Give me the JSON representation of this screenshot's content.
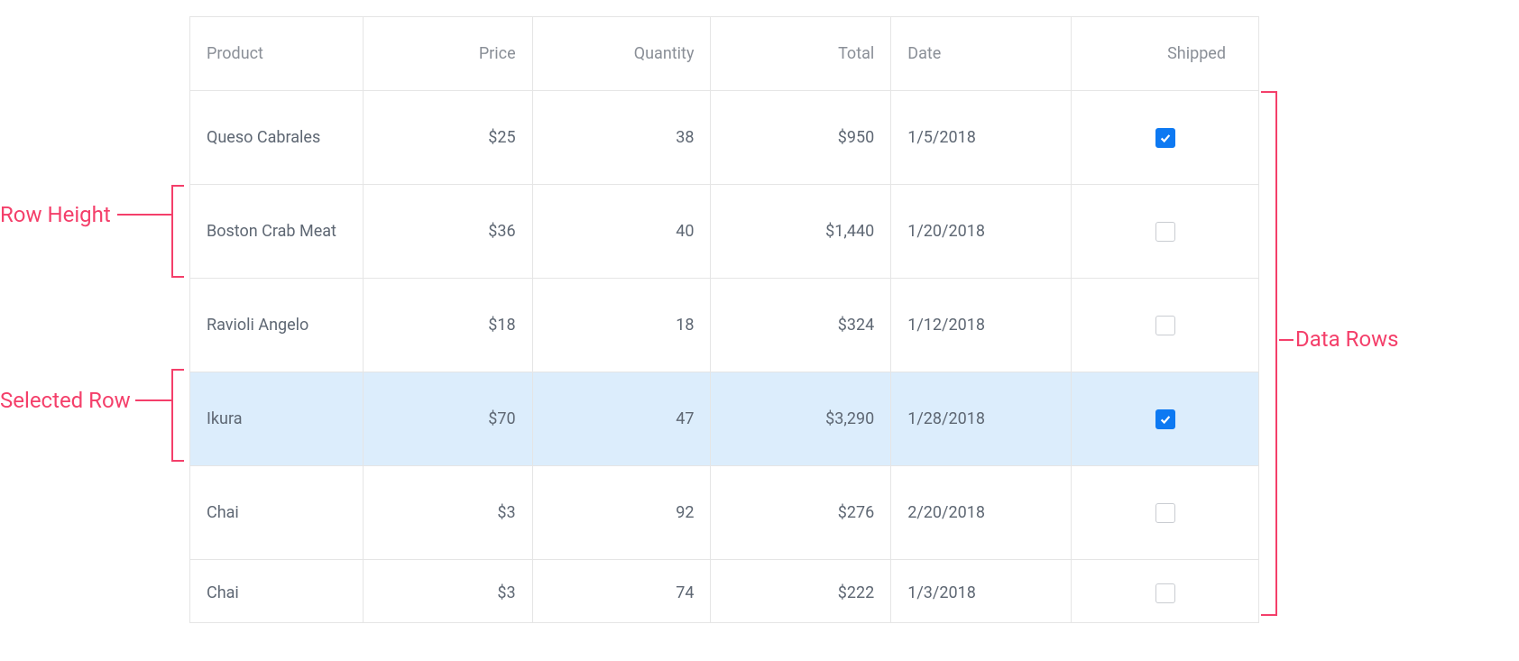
{
  "annotations": {
    "row_height": "Row Height",
    "selected_row": "Selected Row",
    "data_rows": "Data Rows"
  },
  "colors": {
    "accent": "#0d79f2",
    "annotation": "#f43f6a",
    "selected_bg": "#dcedfc",
    "border": "#e5e5e5"
  },
  "table": {
    "headers": {
      "product": "Product",
      "price": "Price",
      "quantity": "Quantity",
      "total": "Total",
      "date": "Date",
      "shipped": "Shipped"
    },
    "rows": [
      {
        "product": "Queso Cabrales",
        "price": "$25",
        "quantity": "38",
        "total": "$950",
        "date": "1/5/2018",
        "shipped": true,
        "selected": false
      },
      {
        "product": "Boston Crab Meat",
        "price": "$36",
        "quantity": "40",
        "total": "$1,440",
        "date": "1/20/2018",
        "shipped": false,
        "selected": false
      },
      {
        "product": "Ravioli Angelo",
        "price": "$18",
        "quantity": "18",
        "total": "$324",
        "date": "1/12/2018",
        "shipped": false,
        "selected": false
      },
      {
        "product": "Ikura",
        "price": "$70",
        "quantity": "47",
        "total": "$3,290",
        "date": "1/28/2018",
        "shipped": true,
        "selected": true
      },
      {
        "product": "Chai",
        "price": "$3",
        "quantity": "92",
        "total": "$276",
        "date": "2/20/2018",
        "shipped": false,
        "selected": false
      },
      {
        "product": "Chai",
        "price": "$3",
        "quantity": "74",
        "total": "$222",
        "date": "1/3/2018",
        "shipped": false,
        "selected": false
      }
    ]
  }
}
